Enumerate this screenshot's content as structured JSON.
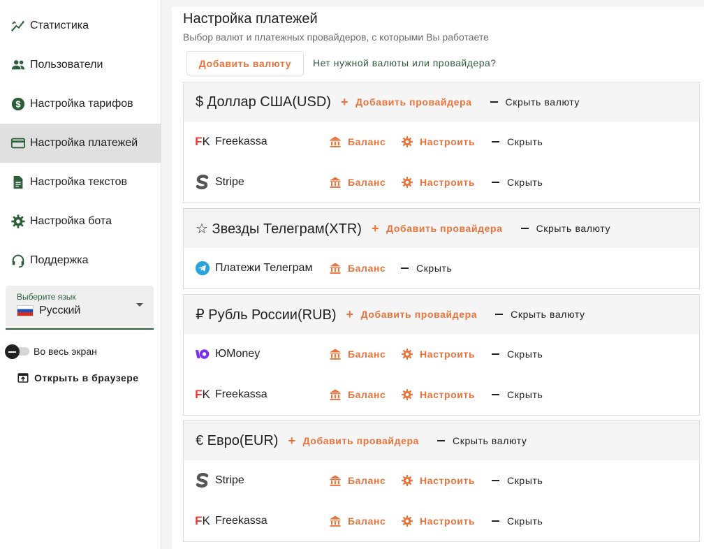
{
  "sidebar": {
    "items": [
      {
        "label": "Статистика",
        "icon": "chart-line-icon"
      },
      {
        "label": "Пользователи",
        "icon": "users-icon"
      },
      {
        "label": "Настройка тарифов",
        "icon": "dollar-circle-icon"
      },
      {
        "label": "Настройка платежей",
        "icon": "credit-card-icon",
        "active": true
      },
      {
        "label": "Настройка текстов",
        "icon": "document-icon"
      },
      {
        "label": "Настройка бота",
        "icon": "gear-icon"
      },
      {
        "label": "Поддержка",
        "icon": "headset-icon"
      }
    ],
    "language": {
      "caption": "Выберите язык",
      "value": "Русский"
    },
    "fullscreen_label": "Во весь экран",
    "open_browser_label": "Открыть в браузере"
  },
  "main": {
    "title": "Настройка платежей",
    "subtitle": "Выбор валют и платежных провайдеров, с которыми Вы работаете",
    "add_currency_label": "Добавить валюту",
    "no_currency_link": "Нет нужной валюты или провайдера?",
    "add_provider_label": "Добавить провайдера",
    "hide_currency_label": "Скрыть валюту",
    "balance_label": "Баланс",
    "configure_label": "Настроить",
    "hide_label": "Скрыть",
    "currencies": [
      {
        "name": "$ Доллар США(USD)",
        "providers": [
          {
            "name": "Freekassa",
            "logo": "freekassa-logo",
            "configurable": true
          },
          {
            "name": "Stripe",
            "logo": "stripe-logo",
            "configurable": true
          }
        ]
      },
      {
        "name": "☆ Звезды Телеграм(XTR)",
        "providers": [
          {
            "name": "Платежи Телеграм",
            "logo": "telegram-logo",
            "configurable": false
          }
        ]
      },
      {
        "name": "₽ Рубль России(RUB)",
        "providers": [
          {
            "name": "ЮMoney",
            "logo": "yoomoney-logo",
            "configurable": true
          },
          {
            "name": "Freekassa",
            "logo": "freekassa-logo",
            "configurable": true
          }
        ]
      },
      {
        "name": "€ Евро(EUR)",
        "providers": [
          {
            "name": "Stripe",
            "logo": "stripe-logo",
            "configurable": true
          },
          {
            "name": "Freekassa",
            "logo": "freekassa-logo",
            "configurable": true
          }
        ]
      }
    ]
  },
  "colors": {
    "accent": "#e8743b",
    "green": "#2e5e3a"
  }
}
